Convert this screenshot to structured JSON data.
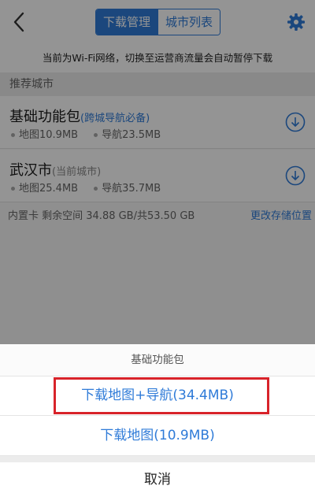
{
  "header": {
    "tabs": [
      "下载管理",
      "城市列表"
    ],
    "active_tab": 0
  },
  "notice": "当前为Wi-Fi网络，切换至运营商流量会自动暂停下载",
  "section_title": "推荐城市",
  "cities": [
    {
      "name": "基础功能包",
      "tag": "(跨城导航必备)",
      "map": "地图10.9MB",
      "nav": "导航23.5MB"
    },
    {
      "name": "武汉市",
      "tag": "(当前城市)",
      "map": "地图25.4MB",
      "nav": "导航35.7MB"
    }
  ],
  "storage": {
    "info": "内置卡 剩余空间 34.88 GB/共53.50 GB",
    "change_label": "更改存储位置"
  },
  "sheet": {
    "title": "基础功能包",
    "option_map_nav": "下载地图+导航(34.4MB)",
    "option_map": "下载地图(10.9MB)",
    "cancel": "取消"
  },
  "colors": {
    "accent": "#2f7bd8",
    "highlight": "#d8232a"
  },
  "icons": [
    "back-chevron-icon",
    "gear-icon",
    "download-icon"
  ]
}
